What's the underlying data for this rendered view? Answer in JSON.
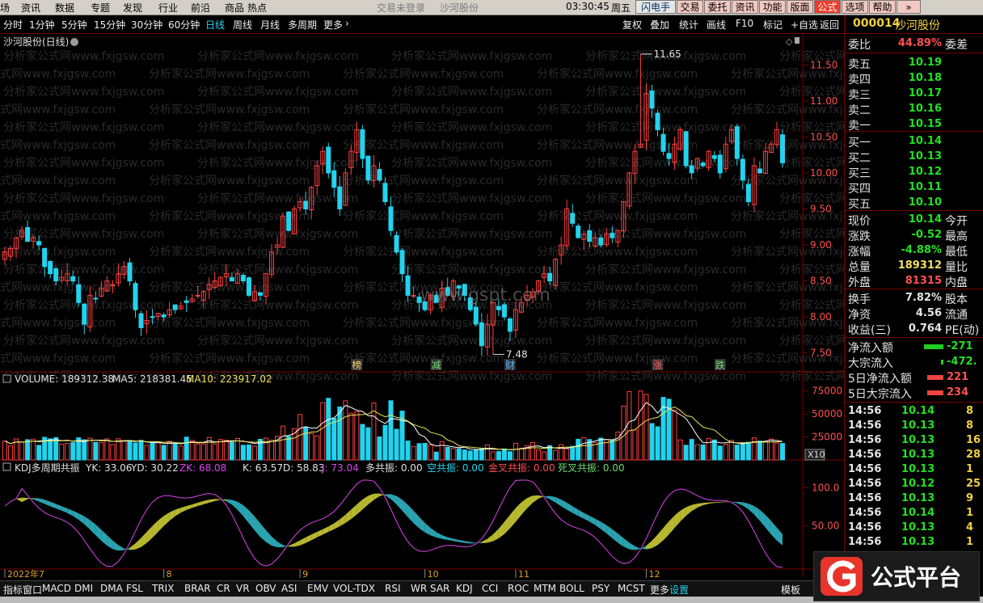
{
  "menu": {
    "items": [
      "场",
      "资讯",
      "数据",
      "专题",
      "发现",
      "行业",
      "前沿",
      "商品",
      "热点"
    ],
    "login": "交易未登录",
    "stock_name": "沙河股份",
    "clock": "03:30:45",
    "weekday": "周五",
    "buttons": [
      {
        "label": "闪电手",
        "bg": "#e6e6e6",
        "fg": "#003366"
      },
      {
        "label": "交易",
        "bg": "#f3c8c0",
        "fg": "#000"
      },
      {
        "label": "委托",
        "bg": "#f3c8c0",
        "fg": "#000"
      },
      {
        "label": "资讯",
        "bg": "#f3c8c0",
        "fg": "#000"
      },
      {
        "label": "功能",
        "bg": "#f3c8c0",
        "fg": "#000"
      },
      {
        "label": "版面",
        "bg": "#f3c8c0",
        "fg": "#000"
      },
      {
        "label": "公式",
        "bg": "#ef3b2c",
        "fg": "#fff"
      },
      {
        "label": "选项",
        "bg": "#f3c8c0",
        "fg": "#000"
      },
      {
        "label": "帮助",
        "bg": "#f3c8c0",
        "fg": "#000"
      },
      {
        "label": "»",
        "bg": "#f3c8c0",
        "fg": "#000"
      }
    ]
  },
  "periods": [
    "分时",
    "1分钟",
    "5分钟",
    "15分钟",
    "30分钟",
    "60分钟",
    "日线",
    "周线",
    "月线",
    "多周期",
    "更多"
  ],
  "selected_period": "日线",
  "tools": [
    "复权",
    "叠加",
    "统计",
    "画线",
    "F10",
    "标记",
    "+自选",
    "返回"
  ],
  "chart_title": "沙河股份(日线)",
  "colors": {
    "up": "#ff4040",
    "down": "#22d3ee",
    "ma5": "#ffffff",
    "ma10": "#e8e85a",
    "kdj_fill_up": "#b8b830",
    "kdj_fill_down": "#2aa3b0",
    "kdj_j": "#dd44ee"
  },
  "price_panel": {
    "ticks": [
      "11.50",
      "11.00",
      "10.50",
      "10.00",
      "9.50",
      "9.00",
      "8.50",
      "8.00",
      "7.50"
    ],
    "high_label": "11.65",
    "low_label": "7.48",
    "watermark": "www.gspt.com",
    "watermark_rows": "分析家公式网www.fxjgsw.com",
    "markers": [
      {
        "text": "榜",
        "color": "#f5d76e",
        "i": 62
      },
      {
        "text": "减",
        "color": "#6fdc6f",
        "i": 76
      },
      {
        "text": "财",
        "color": "#5ab4ff",
        "i": 89
      },
      {
        "text": "涨",
        "color": "#ff6060",
        "i": 115
      },
      {
        "text": "跌",
        "color": "#6fdc6f",
        "i": 126
      }
    ]
  },
  "volume_panel": {
    "label": "VOLUME: 189312.38",
    "ma5": "MA5: 218381.45",
    "ma10": "MA10: 223917.02",
    "ticks": [
      "75000",
      "50000",
      "25000"
    ],
    "unit": "X10"
  },
  "kdj_panel": {
    "name": "KDJ多周期共振",
    "yk": "YK: 33.06",
    "yd": "YD: 30.22",
    "zk": "ZK: 68.08",
    "k": "K: 63.57",
    "d": "D: 58.83",
    "j": "J: 73.04",
    "duo": "多共振: 0.00",
    "kong": "空共振: 0.00",
    "jincha": "金叉共振: 0.00",
    "sicha": "死叉共振: 0.00",
    "ticks": [
      "100.0",
      "50.00"
    ]
  },
  "months": [
    {
      "label": "2022年7",
      "i": 0
    },
    {
      "label": "8",
      "i": 28
    },
    {
      "label": "9",
      "i": 52
    },
    {
      "label": "10",
      "i": 74
    },
    {
      "label": "11",
      "i": 90
    },
    {
      "label": "12",
      "i": 113
    }
  ],
  "tabs": [
    "指标",
    "窗口",
    "MACD",
    "DMI",
    "DMA",
    "FSL",
    "TRIX",
    "BRAR",
    "CR",
    "VR",
    "OBV",
    "ASI",
    "EMV",
    "VOL-TDX",
    "RSI",
    "WR",
    "SAR",
    "KDJ",
    "CCI",
    "ROC",
    "MTM",
    "BOLL",
    "PSY",
    "MCST",
    "更多",
    "设置"
  ],
  "tab_template": "模板",
  "quote": {
    "code": "000014",
    "name": "沙河股份",
    "weibi_label": "委比",
    "weibi_value": "44.89%",
    "weicha_label": "委差",
    "asks": [
      {
        "label": "卖五",
        "price": "10.19"
      },
      {
        "label": "卖四",
        "price": "10.18"
      },
      {
        "label": "卖三",
        "price": "10.17"
      },
      {
        "label": "卖二",
        "price": "10.16"
      },
      {
        "label": "卖一",
        "price": "10.15"
      }
    ],
    "bids": [
      {
        "label": "买一",
        "price": "10.14"
      },
      {
        "label": "买二",
        "price": "10.13"
      },
      {
        "label": "买三",
        "price": "10.12"
      },
      {
        "label": "买四",
        "price": "10.11"
      },
      {
        "label": "买五",
        "price": "10.10"
      }
    ],
    "stats": [
      {
        "label": "现价",
        "value": "10.14",
        "color": "#22e022",
        "side": "今开"
      },
      {
        "label": "涨跌",
        "value": "-0.52",
        "color": "#22e022",
        "side": "最高"
      },
      {
        "label": "涨幅",
        "value": "-4.88%",
        "color": "#22e022",
        "side": "最低"
      },
      {
        "label": "总量",
        "value": "189312",
        "color": "#f0e060",
        "side": "量比"
      },
      {
        "label": "外盘",
        "value": "81315",
        "color": "#ff5050",
        "side": "内盘"
      }
    ],
    "stats2": [
      {
        "label": "换手",
        "value": "7.82%",
        "side": "股本"
      },
      {
        "label": "净资",
        "value": "4.56",
        "side": "流通"
      },
      {
        "label": "收益(三)",
        "value": "0.764",
        "side": "PE(动)"
      }
    ],
    "flows": [
      {
        "label": "净流入额",
        "value": "-271",
        "bar": "#22cc22",
        "barw": 24
      },
      {
        "label": "大宗流入",
        "value": "-472.",
        "bar": "#22cc22",
        "barw": 3
      },
      {
        "label": "5日净流入额",
        "value": "221",
        "bar": "#ee4444",
        "barw": 20
      },
      {
        "label": "5日大宗流入",
        "value": "234",
        "bar": "#ee4444",
        "barw": 20
      }
    ],
    "ticks": [
      {
        "time": "14:56",
        "price": "10.14",
        "vol": "8"
      },
      {
        "time": "14:56",
        "price": "10.13",
        "vol": "8"
      },
      {
        "time": "14:56",
        "price": "10.13",
        "vol": "16"
      },
      {
        "time": "14:56",
        "price": "10.13",
        "vol": "28"
      },
      {
        "time": "14:56",
        "price": "10.13",
        "vol": "1"
      },
      {
        "time": "14:56",
        "price": "10.12",
        "vol": "25"
      },
      {
        "time": "14:56",
        "price": "10.13",
        "vol": "9"
      },
      {
        "time": "14:56",
        "price": "10.14",
        "vol": "1"
      },
      {
        "time": "14:56",
        "price": "10.13",
        "vol": "4"
      },
      {
        "time": "14:56",
        "price": "10.13",
        "vol": "1"
      }
    ]
  },
  "logo": {
    "text": "公式平台"
  }
}
